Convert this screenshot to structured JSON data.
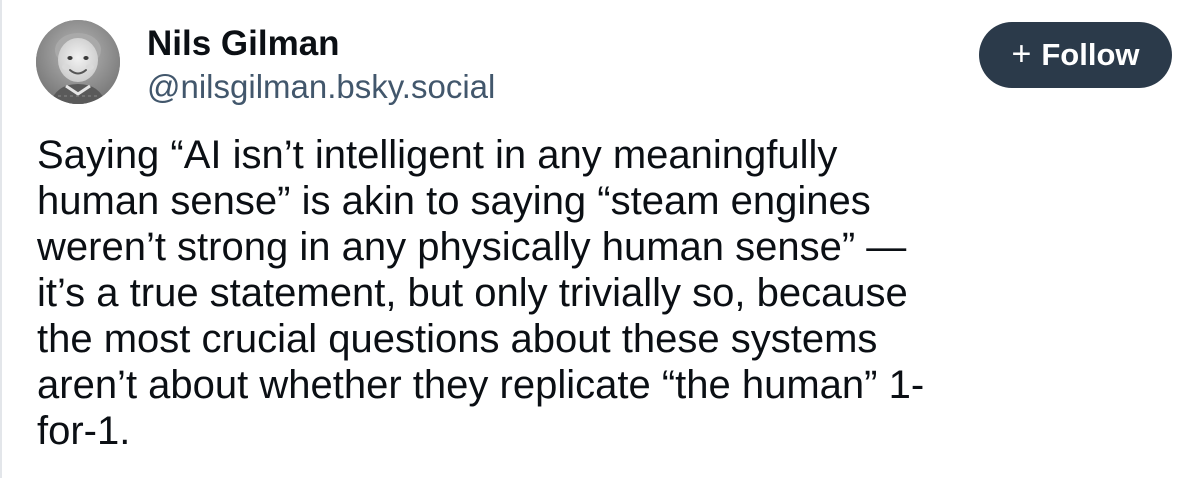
{
  "post": {
    "author": {
      "display_name": "Nils Gilman",
      "handle": "@nilsgilman.bsky.social",
      "avatar_icon": "avatar-photo-child"
    },
    "follow_button": {
      "icon": "plus-icon",
      "icon_glyph": "+",
      "label": "Follow",
      "background": "#2b3a4a",
      "text_color": "#ffffff"
    },
    "text_lines": [
      "Saying “AI isn’t intelligent in any meaningfully",
      "human sense” is akin to saying “steam engines",
      "weren’t strong in any physically human sense” —",
      "it’s a true statement, but only trivially so, because",
      "the most crucial questions about these systems",
      "aren’t about whether they replicate “the human” 1-",
      "for-1."
    ]
  },
  "colors": {
    "text": "#0b0f14",
    "handle": "#42576c",
    "background": "#ffffff"
  }
}
